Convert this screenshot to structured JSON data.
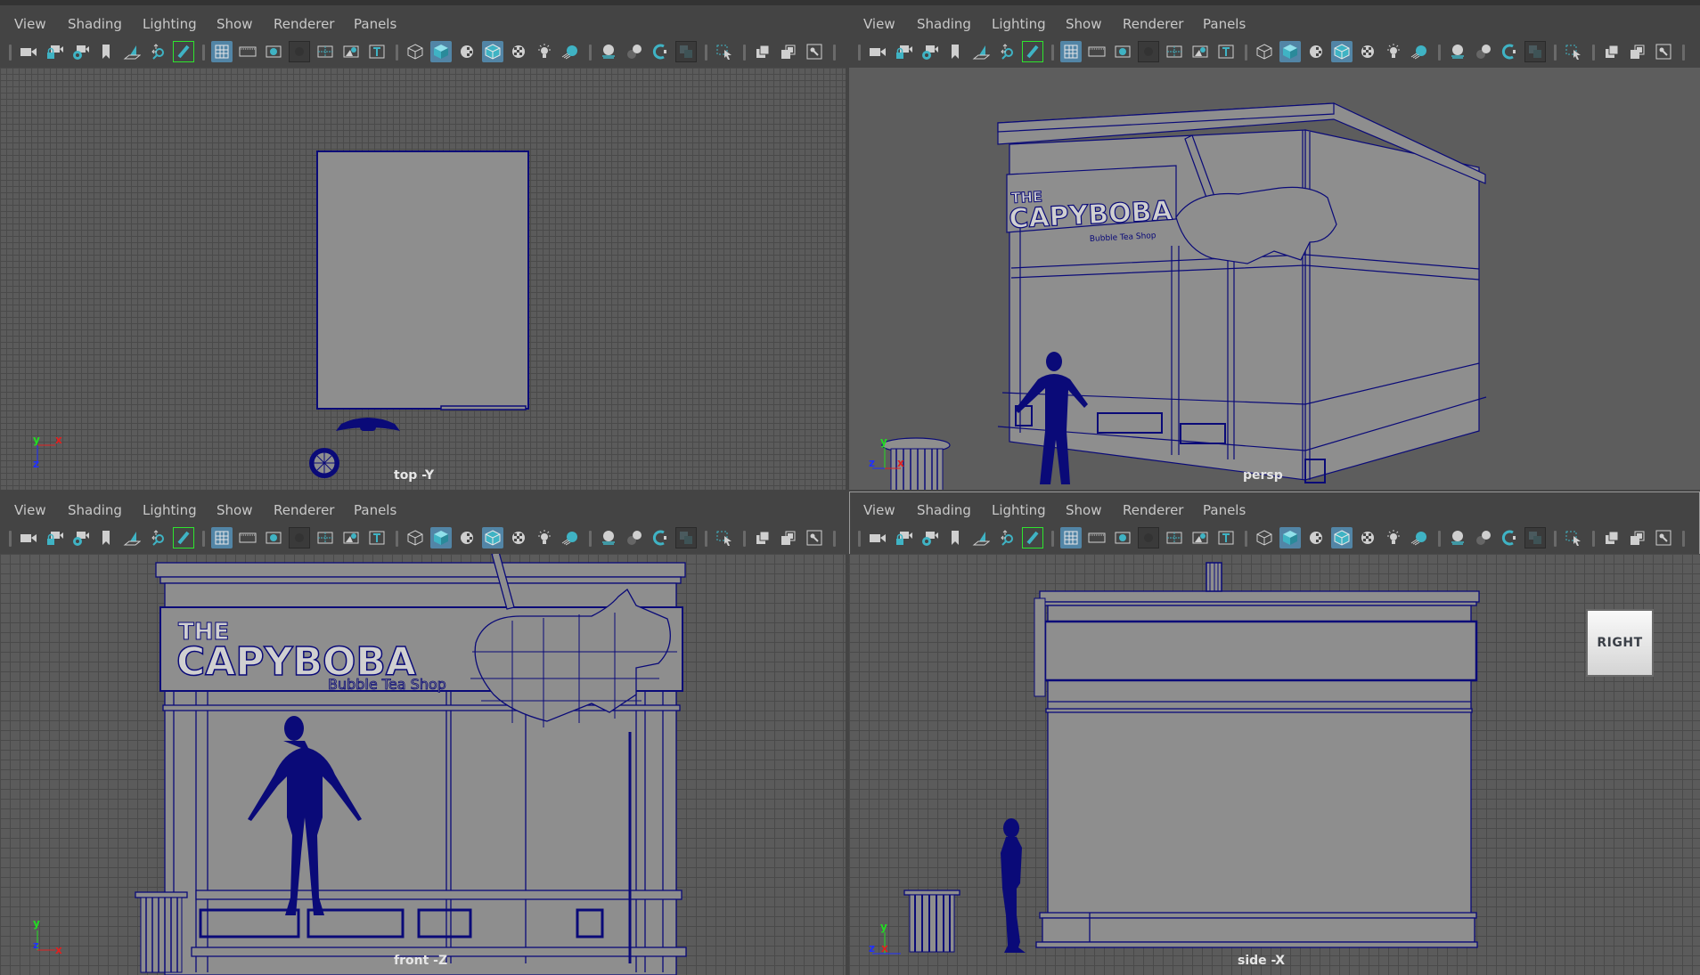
{
  "menus": [
    "View",
    "Shading",
    "Lighting",
    "Show",
    "Renderer",
    "Panels"
  ],
  "toolbar_icons": [
    "camera-icon",
    "camera-lock-icon",
    "camera-attributes-icon",
    "bookmark-icon",
    "image-plane-icon",
    "2d-pan-zoom-icon",
    "grease-pencil-icon",
    "separator",
    "grid-icon",
    "film-gate-icon",
    "resolution-gate-icon",
    "gate-mask-icon",
    "field-chart-icon",
    "safe-action-icon",
    "safe-title-icon",
    "separator",
    "wireframe-icon",
    "smooth-shade-icon",
    "default-material-icon",
    "wireframe-on-shaded-icon",
    "textured-icon",
    "use-all-lights-icon",
    "shadows-icon",
    "separator",
    "screen-space-ao-icon",
    "motion-blur-icon",
    "multisample-aa-icon",
    "depth-of-field-icon",
    "separator",
    "isolate-select-icon",
    "separator",
    "xray-icon",
    "xray-active-components-icon",
    "xray-joints-icon",
    "separator"
  ],
  "toolbar_states": {
    "grid-icon": "on",
    "smooth-shade-icon": "on",
    "wireframe-on-shaded-icon": "on",
    "grease-pencil-icon": "green",
    "gate-mask-icon": "pressed",
    "depth-of-field-icon": "pressed"
  },
  "panels": [
    {
      "id": "top",
      "camera_label": "top -Y",
      "axis": {
        "a": "y",
        "b": "x",
        "c": "z"
      }
    },
    {
      "id": "persp",
      "camera_label": "persp",
      "axis": {
        "a": "y",
        "b": "x",
        "c": "z"
      }
    },
    {
      "id": "front",
      "camera_label": "front -Z",
      "axis": {
        "a": "y",
        "b": "x",
        "c": "z"
      }
    },
    {
      "id": "side",
      "camera_label": "side -X",
      "axis": {
        "a": "y",
        "b": "x",
        "c": "z"
      },
      "viewcube": "RIGHT"
    }
  ],
  "sign": {
    "line1": "THE",
    "line2": "CAPYBOBA",
    "line3": "Bubble Tea Shop"
  },
  "colors": {
    "wire": "#0a0a78",
    "accent": "#5285a6",
    "icon_teal": "#3fb3c4",
    "axis_x": "#e02020",
    "axis_y": "#22dd22",
    "axis_z": "#2030ff"
  }
}
